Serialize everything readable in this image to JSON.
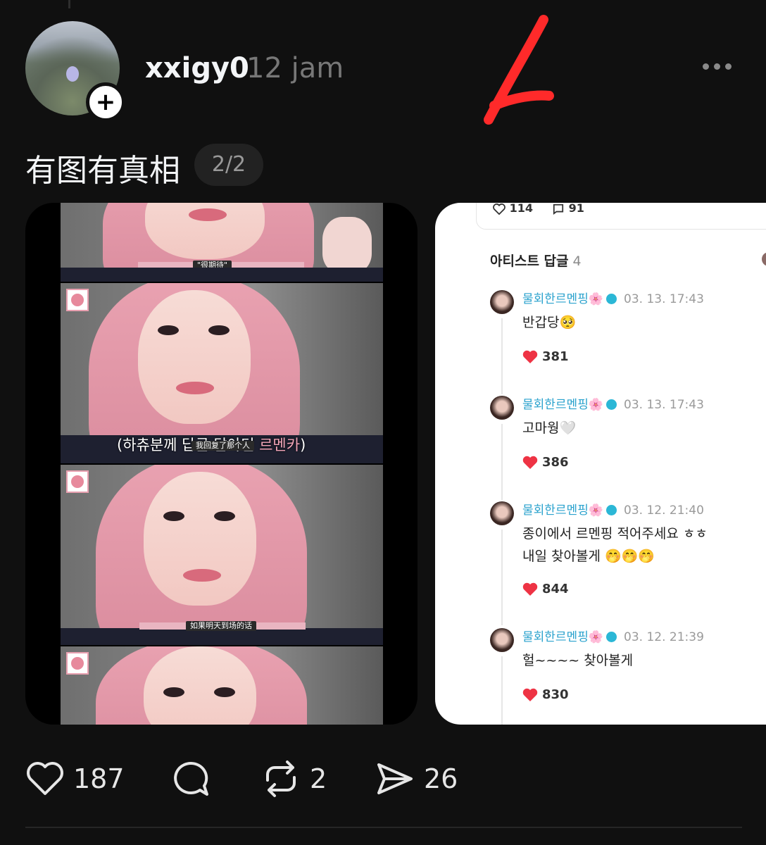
{
  "post": {
    "username": "xxigy0",
    "timestamp": "12 jam",
    "text": "有图有真相",
    "page_indicator": "2/2"
  },
  "media_left": {
    "sub_label_1": "\"很期待\"",
    "caption_prefix": "(하츄분께 ",
    "caption_mid": "답글 달아던 ",
    "caption_name": "르멘카",
    "caption_suffix": ")",
    "sub_label_2": "我回复了那个人",
    "sub_label_3": "如果明天到场的话"
  },
  "media_right": {
    "likes": "114",
    "comments": "91",
    "section_title": "아티스트 답글",
    "section_count": "4",
    "replies": [
      {
        "name": "물회한르멘핑🌸",
        "time": "03. 13. 17:43",
        "text1": "반갑당🥺",
        "text2": "",
        "likes": "381"
      },
      {
        "name": "물회한르멘핑🌸",
        "time": "03. 13. 17:43",
        "text1": "고마웡🤍",
        "text2": "",
        "likes": "386"
      },
      {
        "name": "물회한르멘핑🌸",
        "time": "03. 12. 21:40",
        "text1": "종이에서 르멘핑 적어주세요 ㅎㅎ",
        "text2": "내일 찾아볼게 🤭🤭🤭",
        "likes": "844"
      },
      {
        "name": "물회한르멘핑🌸",
        "time": "03. 12. 21:39",
        "text1": "헐~~~~ 찾아볼게",
        "text2": "",
        "likes": "830"
      }
    ]
  },
  "actions": {
    "like_count": "187",
    "repost_count": "2",
    "share_count": "26"
  },
  "colors": {
    "background": "#101010",
    "accent_red": "#ff2a2a",
    "artist_name": "#2aa2cd",
    "heart_red": "#ee3344"
  },
  "icons": [
    "follow-plus-icon",
    "more-icon",
    "heart-icon",
    "comment-icon",
    "repost-icon",
    "share-icon",
    "verified-badge-icon"
  ]
}
